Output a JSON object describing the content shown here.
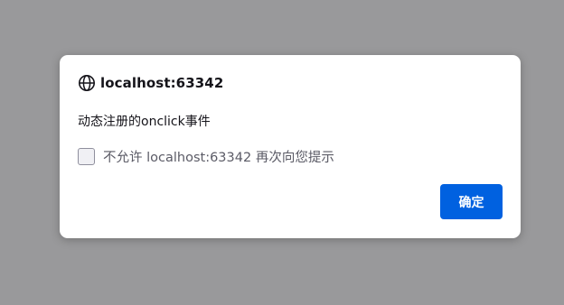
{
  "dialog": {
    "origin": "localhost:63342",
    "message": "动态注册的onclick事件",
    "checkbox_label": "不允许 localhost:63342 再次向您提示",
    "checkbox_checked": false,
    "ok_label": "确定",
    "origin_icon": "globe-icon"
  },
  "colors": {
    "backdrop": "#99999b",
    "accent": "#0061e0"
  }
}
